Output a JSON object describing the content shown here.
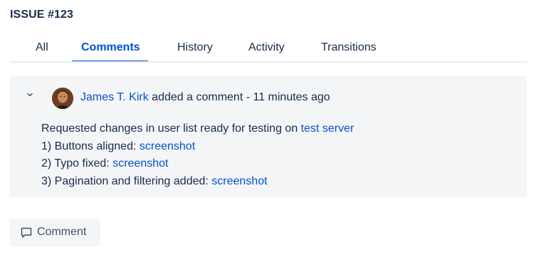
{
  "issue": {
    "title": "ISSUE #123"
  },
  "tabs": [
    {
      "label": "All",
      "active": false
    },
    {
      "label": "Comments",
      "active": true
    },
    {
      "label": "History",
      "active": false
    },
    {
      "label": "Activity",
      "active": false
    },
    {
      "label": "Transitions",
      "active": false
    }
  ],
  "comment": {
    "author": "James T. Kirk",
    "action": " added a comment - 11 minutes ago",
    "lines": [
      {
        "text": "Requested changes in user list ready for testing on ",
        "link": "test server"
      },
      {
        "text": "1) Buttons aligned: ",
        "link": "screenshot"
      },
      {
        "text": "2) Typo fixed: ",
        "link": "screenshot"
      },
      {
        "text": "3) Pagination and filtering added: ",
        "link": "screenshot"
      }
    ]
  },
  "actions": {
    "comment_button_label": "Comment"
  },
  "colors": {
    "accent": "#0052cc",
    "text": "#172b4d",
    "card_background": "#f4f5f7",
    "tab_rule": "#ebecf0"
  },
  "icons": {
    "collapse": "chevron-down-icon",
    "comment": "speech-bubble-icon"
  }
}
